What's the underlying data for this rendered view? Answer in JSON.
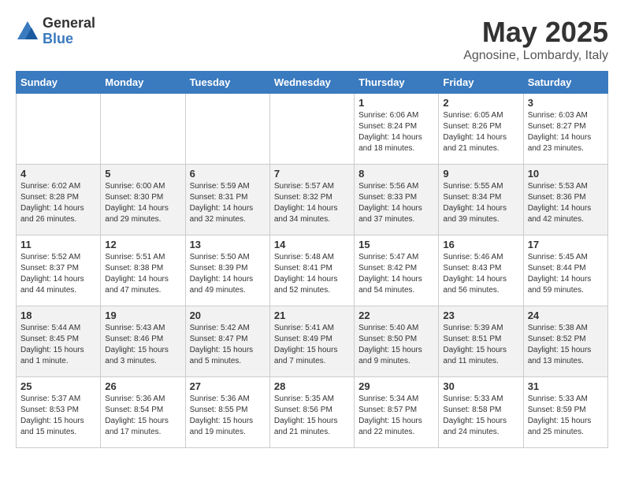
{
  "logo": {
    "general": "General",
    "blue": "Blue"
  },
  "title": "May 2025",
  "location": "Agnosine, Lombardy, Italy",
  "days_of_week": [
    "Sunday",
    "Monday",
    "Tuesday",
    "Wednesday",
    "Thursday",
    "Friday",
    "Saturday"
  ],
  "weeks": [
    [
      {
        "day": "",
        "info": ""
      },
      {
        "day": "",
        "info": ""
      },
      {
        "day": "",
        "info": ""
      },
      {
        "day": "",
        "info": ""
      },
      {
        "day": "1",
        "info": "Sunrise: 6:06 AM\nSunset: 8:24 PM\nDaylight: 14 hours\nand 18 minutes."
      },
      {
        "day": "2",
        "info": "Sunrise: 6:05 AM\nSunset: 8:26 PM\nDaylight: 14 hours\nand 21 minutes."
      },
      {
        "day": "3",
        "info": "Sunrise: 6:03 AM\nSunset: 8:27 PM\nDaylight: 14 hours\nand 23 minutes."
      }
    ],
    [
      {
        "day": "4",
        "info": "Sunrise: 6:02 AM\nSunset: 8:28 PM\nDaylight: 14 hours\nand 26 minutes."
      },
      {
        "day": "5",
        "info": "Sunrise: 6:00 AM\nSunset: 8:30 PM\nDaylight: 14 hours\nand 29 minutes."
      },
      {
        "day": "6",
        "info": "Sunrise: 5:59 AM\nSunset: 8:31 PM\nDaylight: 14 hours\nand 32 minutes."
      },
      {
        "day": "7",
        "info": "Sunrise: 5:57 AM\nSunset: 8:32 PM\nDaylight: 14 hours\nand 34 minutes."
      },
      {
        "day": "8",
        "info": "Sunrise: 5:56 AM\nSunset: 8:33 PM\nDaylight: 14 hours\nand 37 minutes."
      },
      {
        "day": "9",
        "info": "Sunrise: 5:55 AM\nSunset: 8:34 PM\nDaylight: 14 hours\nand 39 minutes."
      },
      {
        "day": "10",
        "info": "Sunrise: 5:53 AM\nSunset: 8:36 PM\nDaylight: 14 hours\nand 42 minutes."
      }
    ],
    [
      {
        "day": "11",
        "info": "Sunrise: 5:52 AM\nSunset: 8:37 PM\nDaylight: 14 hours\nand 44 minutes."
      },
      {
        "day": "12",
        "info": "Sunrise: 5:51 AM\nSunset: 8:38 PM\nDaylight: 14 hours\nand 47 minutes."
      },
      {
        "day": "13",
        "info": "Sunrise: 5:50 AM\nSunset: 8:39 PM\nDaylight: 14 hours\nand 49 minutes."
      },
      {
        "day": "14",
        "info": "Sunrise: 5:48 AM\nSunset: 8:41 PM\nDaylight: 14 hours\nand 52 minutes."
      },
      {
        "day": "15",
        "info": "Sunrise: 5:47 AM\nSunset: 8:42 PM\nDaylight: 14 hours\nand 54 minutes."
      },
      {
        "day": "16",
        "info": "Sunrise: 5:46 AM\nSunset: 8:43 PM\nDaylight: 14 hours\nand 56 minutes."
      },
      {
        "day": "17",
        "info": "Sunrise: 5:45 AM\nSunset: 8:44 PM\nDaylight: 14 hours\nand 59 minutes."
      }
    ],
    [
      {
        "day": "18",
        "info": "Sunrise: 5:44 AM\nSunset: 8:45 PM\nDaylight: 15 hours\nand 1 minute."
      },
      {
        "day": "19",
        "info": "Sunrise: 5:43 AM\nSunset: 8:46 PM\nDaylight: 15 hours\nand 3 minutes."
      },
      {
        "day": "20",
        "info": "Sunrise: 5:42 AM\nSunset: 8:47 PM\nDaylight: 15 hours\nand 5 minutes."
      },
      {
        "day": "21",
        "info": "Sunrise: 5:41 AM\nSunset: 8:49 PM\nDaylight: 15 hours\nand 7 minutes."
      },
      {
        "day": "22",
        "info": "Sunrise: 5:40 AM\nSunset: 8:50 PM\nDaylight: 15 hours\nand 9 minutes."
      },
      {
        "day": "23",
        "info": "Sunrise: 5:39 AM\nSunset: 8:51 PM\nDaylight: 15 hours\nand 11 minutes."
      },
      {
        "day": "24",
        "info": "Sunrise: 5:38 AM\nSunset: 8:52 PM\nDaylight: 15 hours\nand 13 minutes."
      }
    ],
    [
      {
        "day": "25",
        "info": "Sunrise: 5:37 AM\nSunset: 8:53 PM\nDaylight: 15 hours\nand 15 minutes."
      },
      {
        "day": "26",
        "info": "Sunrise: 5:36 AM\nSunset: 8:54 PM\nDaylight: 15 hours\nand 17 minutes."
      },
      {
        "day": "27",
        "info": "Sunrise: 5:36 AM\nSunset: 8:55 PM\nDaylight: 15 hours\nand 19 minutes."
      },
      {
        "day": "28",
        "info": "Sunrise: 5:35 AM\nSunset: 8:56 PM\nDaylight: 15 hours\nand 21 minutes."
      },
      {
        "day": "29",
        "info": "Sunrise: 5:34 AM\nSunset: 8:57 PM\nDaylight: 15 hours\nand 22 minutes."
      },
      {
        "day": "30",
        "info": "Sunrise: 5:33 AM\nSunset: 8:58 PM\nDaylight: 15 hours\nand 24 minutes."
      },
      {
        "day": "31",
        "info": "Sunrise: 5:33 AM\nSunset: 8:59 PM\nDaylight: 15 hours\nand 25 minutes."
      }
    ]
  ]
}
